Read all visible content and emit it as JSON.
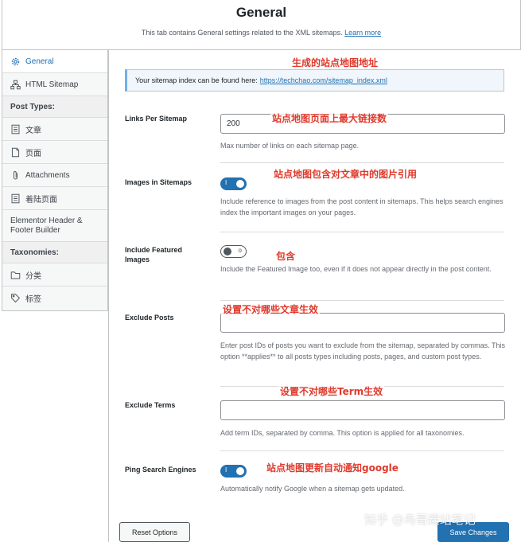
{
  "header": {
    "title": "General",
    "description": "This tab contains General settings related to the XML sitemaps.",
    "learn_more": "Learn more"
  },
  "sidebar": {
    "items": [
      {
        "label": "General",
        "icon": "gear-icon"
      },
      {
        "label": "HTML Sitemap",
        "icon": "sitemap-icon"
      }
    ],
    "post_types_heading": "Post Types:",
    "post_types": [
      {
        "label": "文章",
        "icon": "post-icon"
      },
      {
        "label": "页面",
        "icon": "page-icon"
      },
      {
        "label": "Attachments",
        "icon": "attachment-icon"
      },
      {
        "label": "着陆页面",
        "icon": "landing-page-icon"
      },
      {
        "label": "Elementor Header & Footer Builder",
        "icon": "template-icon"
      }
    ],
    "taxonomies_heading": "Taxonomies:",
    "taxonomies": [
      {
        "label": "分类",
        "icon": "folder-icon"
      },
      {
        "label": "标签",
        "icon": "tag-icon"
      }
    ]
  },
  "notice": {
    "text": "Your sitemap index can be found here:",
    "link": "https://techchao.com/sitemap_index.xml"
  },
  "settings": {
    "links_per_sitemap": {
      "label": "Links Per Sitemap",
      "value": "200",
      "help": "Max number of links on each sitemap page."
    },
    "images_in_sitemaps": {
      "label": "Images in Sitemaps",
      "enabled": true,
      "help": "Include reference to images from the post content in sitemaps. This helps search engines index the important images on your pages."
    },
    "include_featured_images": {
      "label": "Include Featured Images",
      "enabled": false,
      "help": "Include the Featured Image too, even if it does not appear directly in the post content."
    },
    "exclude_posts": {
      "label": "Exclude Posts",
      "value": "",
      "help": "Enter post IDs of posts you want to exclude from the sitemap, separated by commas. This option **applies** to all posts types including posts, pages, and custom post types."
    },
    "exclude_terms": {
      "label": "Exclude Terms",
      "value": "",
      "help": "Add term IDs, separated by comma. This option is applied for all taxonomies."
    },
    "ping_search_engines": {
      "label": "Ping Search Engines",
      "enabled": true,
      "help": "Automatically notify Google when a sitemap gets updated."
    }
  },
  "annotations": {
    "sitemap_address": "生成的站点地图地址",
    "max_links": "站点地图页面上最大链接数",
    "include_images": "站点地图包含对文章中的图片引用",
    "include": "包含",
    "exclude_posts": "设置不对哪些文章生效",
    "exclude_terms": "设置不对哪些Term生效",
    "ping": "站点地图更新自动通知google"
  },
  "buttons": {
    "reset": "Reset Options",
    "save": "Save Changes"
  },
  "watermark": "知乎 @鸟哥建站笔记",
  "colors": {
    "accent": "#2271b1",
    "annotation": "#e0392b"
  }
}
